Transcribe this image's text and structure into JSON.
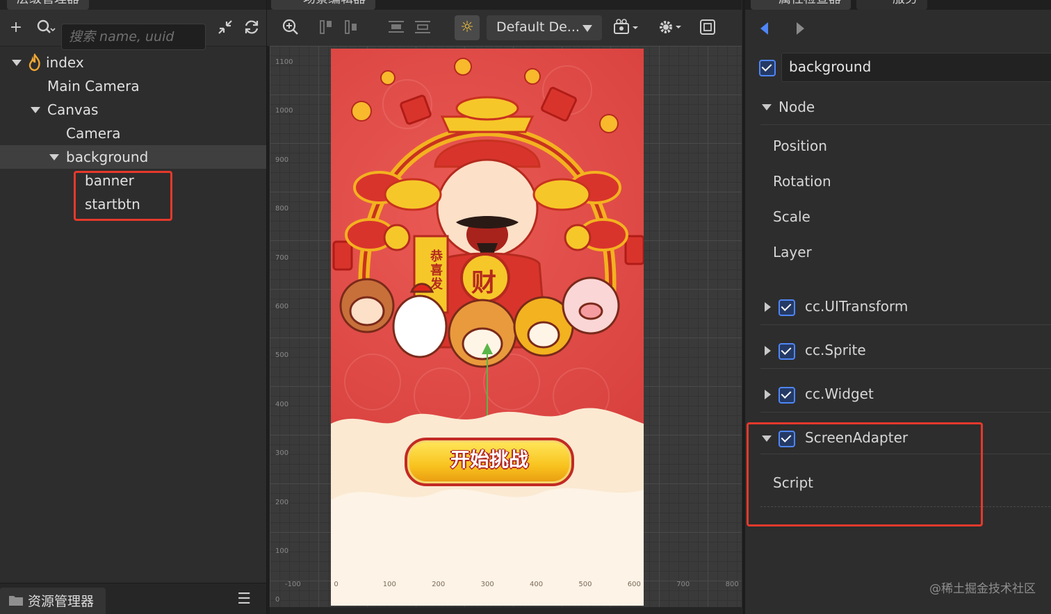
{
  "hierarchy": {
    "tab_label": "层级管理器",
    "search_placeholder": "搜索 name, uuid",
    "nodes": [
      {
        "label": "index"
      },
      {
        "label": "Main Camera"
      },
      {
        "label": "Canvas"
      },
      {
        "label": "Camera"
      },
      {
        "label": "background"
      },
      {
        "label": "banner"
      },
      {
        "label": "startbtn"
      }
    ],
    "assets_tab_label": "资源管理器"
  },
  "scene": {
    "tab_label": "场景编辑器",
    "device_select": "Default De...",
    "ruler_y": [
      "1100",
      "1000",
      "900",
      "800",
      "700",
      "600",
      "500",
      "400",
      "300",
      "200",
      "100",
      "0"
    ],
    "ruler_x": [
      "-100",
      "0",
      "100",
      "200",
      "300",
      "400",
      "500",
      "600",
      "700",
      "800"
    ],
    "game": {
      "start_button_label": "开始挑战",
      "scroll_text": "恭喜发",
      "coin_text": "财"
    }
  },
  "inspector": {
    "tab_label": "属性检查器",
    "tab2_label": "服务",
    "node_name": "background",
    "node_section": "Node",
    "props": [
      "Position",
      "Rotation",
      "Scale",
      "Layer"
    ],
    "components": [
      "cc.UITransform",
      "cc.Sprite",
      "cc.Widget",
      "ScreenAdapter"
    ],
    "script_label": "Script"
  },
  "watermark": "@稀土掘金技术社区",
  "colors": {
    "accent": "#4f86f7",
    "highlight": "#e5392b",
    "scene_bg": "#d9423f",
    "button": "#f8c21e"
  }
}
